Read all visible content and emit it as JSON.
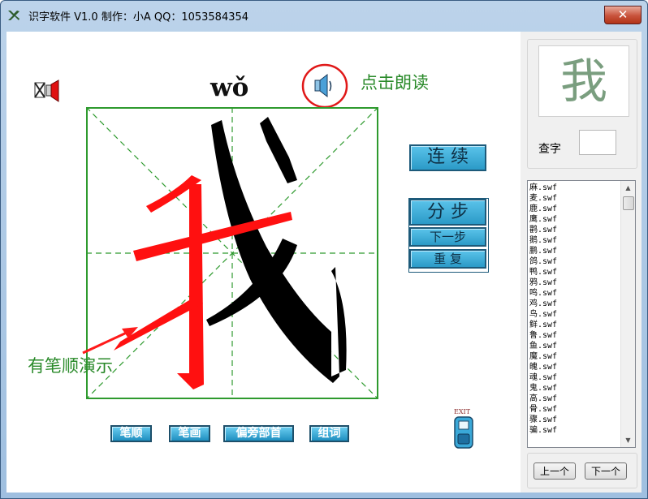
{
  "window": {
    "title": "识字软件 V1.0 制作：小A QQ：1053584354",
    "close_label": "✕"
  },
  "character": {
    "glyph": "我",
    "pinyin": "wǒ"
  },
  "speaker": {
    "label": "点击朗读"
  },
  "buttons": {
    "continuous": "连  续",
    "stepwise": "分  步",
    "next_step": "下一步",
    "repeat": "重  复",
    "exit": "EXIT"
  },
  "bottom_buttons": [
    "笔顺",
    "笔画",
    "偏旁部首",
    "组词"
  ],
  "annotation": "有笔顺演示",
  "lookup": {
    "label": "查字",
    "value": ""
  },
  "file_list": [
    "麻.swf",
    "麦.swf",
    "鹿.swf",
    "鹰.swf",
    "鹳.swf",
    "鹅.swf",
    "鹏.swf",
    "鸽.swf",
    "鸭.swf",
    "鸦.swf",
    "鸣.swf",
    "鸡.swf",
    "鸟.swf",
    "鲜.swf",
    "鲁.swf",
    "鱼.swf",
    "魔.swf",
    "魄.swf",
    "魂.swf",
    "鬼.swf",
    "高.swf",
    "骨.swf",
    "骤.swf",
    "骗.swf"
  ],
  "nav": {
    "prev": "上一个",
    "next": "下一个"
  },
  "colors": {
    "guide_green": "#2e9a2e",
    "active_stroke": "#ff1010",
    "done_stroke": "#000000",
    "button_blue": "#2b9ac7",
    "label_green": "#2a8a2a"
  },
  "icons": [
    "app-icon",
    "close-icon",
    "sound-toggle-icon",
    "speaker-icon",
    "arrow-icon",
    "exit-icon"
  ]
}
